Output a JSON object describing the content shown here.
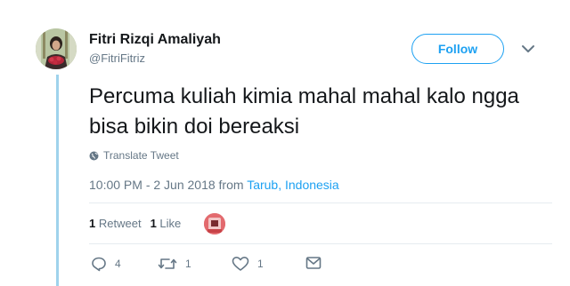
{
  "user": {
    "name": "Fitri Rizqi Amaliyah",
    "handle": "@FitriFitriz"
  },
  "follow_label": "Follow",
  "tweet": {
    "text": "Percuma kuliah kimia mahal mahal kalo ngga bisa bikin doi bereaksi",
    "translate_label": "Translate Tweet",
    "timestamp": "10:00 PM - 2 Jun 2018",
    "from_word": "from",
    "location": "Tarub, Indonesia"
  },
  "stats": {
    "retweet_count": "1",
    "retweet_label": "Retweet",
    "like_count": "1",
    "like_label": "Like"
  },
  "actions": {
    "reply_count": "4",
    "retweet_count": "1",
    "like_count": "1"
  },
  "icons": {
    "avatar": "profile-photo",
    "caret": "chevron-down-icon",
    "translate": "globe-icon",
    "reply": "reply-icon",
    "retweet": "retweet-icon",
    "like": "heart-icon",
    "dm": "envelope-icon"
  },
  "colors": {
    "accent": "#1da1f2",
    "muted": "#657786",
    "thread_line": "#9fd3ec"
  }
}
